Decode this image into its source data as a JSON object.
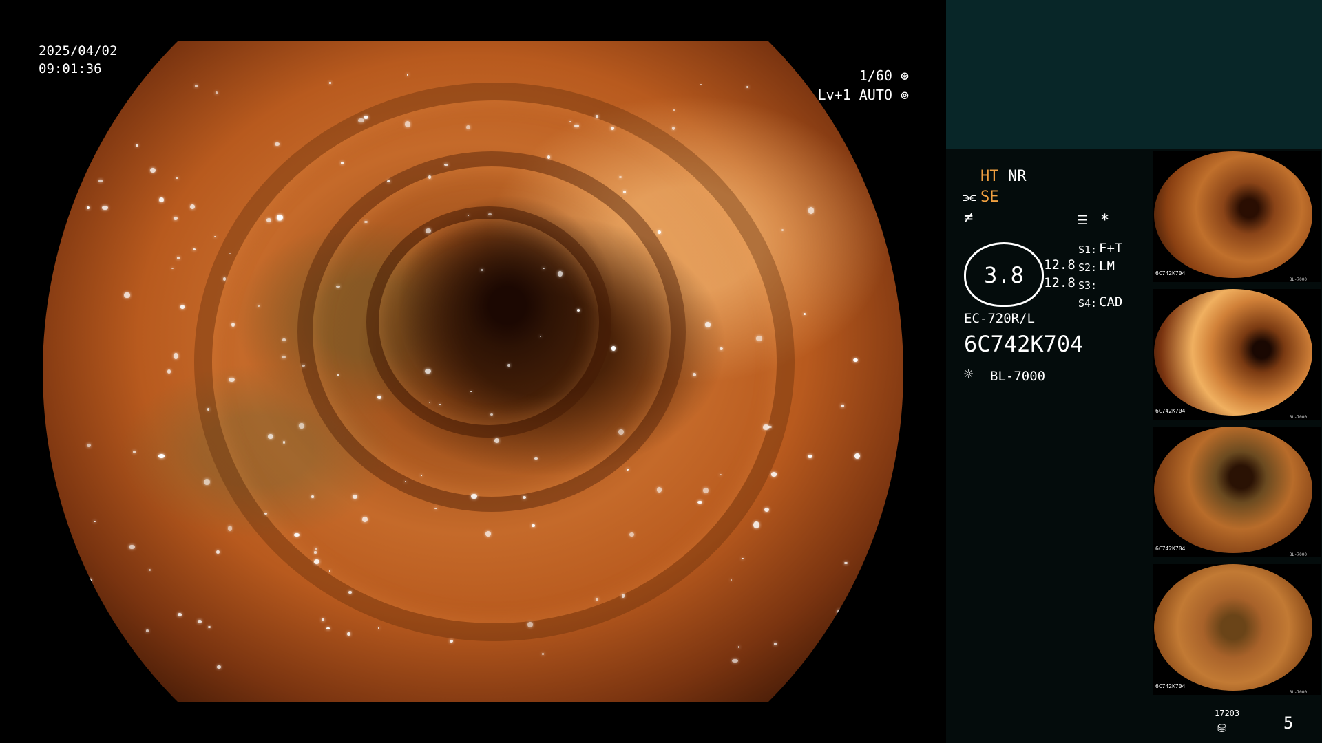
{
  "overlay": {
    "date": "2025/04/02",
    "time": "09:01:36",
    "shutter": "1/60",
    "shutter_icon": "shutter-icon",
    "level": "Lv+1 AUTO",
    "level_icon": "iris-icon"
  },
  "panel": {
    "ht": "HT",
    "nr": "NR",
    "se": "SE",
    "mode_icon_1": "structure-enhance-icon",
    "mode_icon_2": "color-enhance-icon",
    "menu_icon": "menu-list-icon",
    "star": "*",
    "bezel_value": "3.8",
    "value_a": "12.8",
    "value_b": "12.8",
    "s1_label": "S1:",
    "s1_value": "F+T",
    "s2_label": "S2:",
    "s2_value": "LM",
    "s3_label": "S3:",
    "s3_value": "",
    "s4_label": "S4:",
    "s4_value": "CAD",
    "scope_model": "EC-720R/L",
    "scope_serial": "6C742K704",
    "light_icon": "light-source-icon",
    "light_source": "BL-7000",
    "counter": "17203",
    "counter_icon": "storage-icon",
    "capture_count": "5"
  },
  "thumbnails": [
    {
      "label": "6C742K704",
      "meta": "BL-7000"
    },
    {
      "label": "6C742K704",
      "meta": "BL-7000"
    },
    {
      "label": "6C742K704",
      "meta": "BL-7000"
    },
    {
      "label": "6C742K704",
      "meta": "BL-7000"
    }
  ],
  "colors": {
    "accent_yellow": "#f0a040",
    "panel_bg": "#040c0c",
    "teal_band": "#082628"
  }
}
